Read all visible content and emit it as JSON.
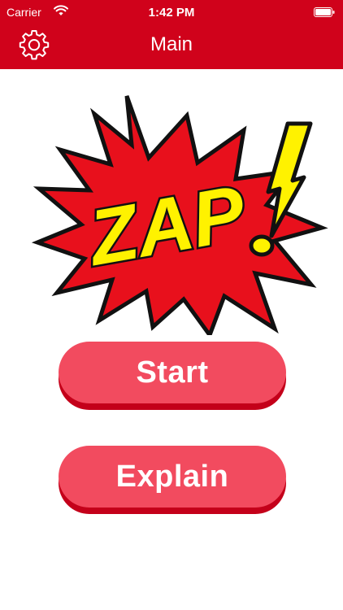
{
  "status_bar": {
    "carrier": "Carrier",
    "time": "1:42 PM"
  },
  "nav": {
    "title": "Main",
    "settings_icon": "gear-icon"
  },
  "illustration": {
    "text": "ZAP"
  },
  "buttons": {
    "start_label": "Start",
    "explain_label": "Explain"
  },
  "colors": {
    "header": "#D0021B",
    "button_face": "#F24B5F",
    "button_shadow": "#C4001A",
    "zap_yellow": "#FFF200",
    "burst_red": "#E8101C"
  }
}
